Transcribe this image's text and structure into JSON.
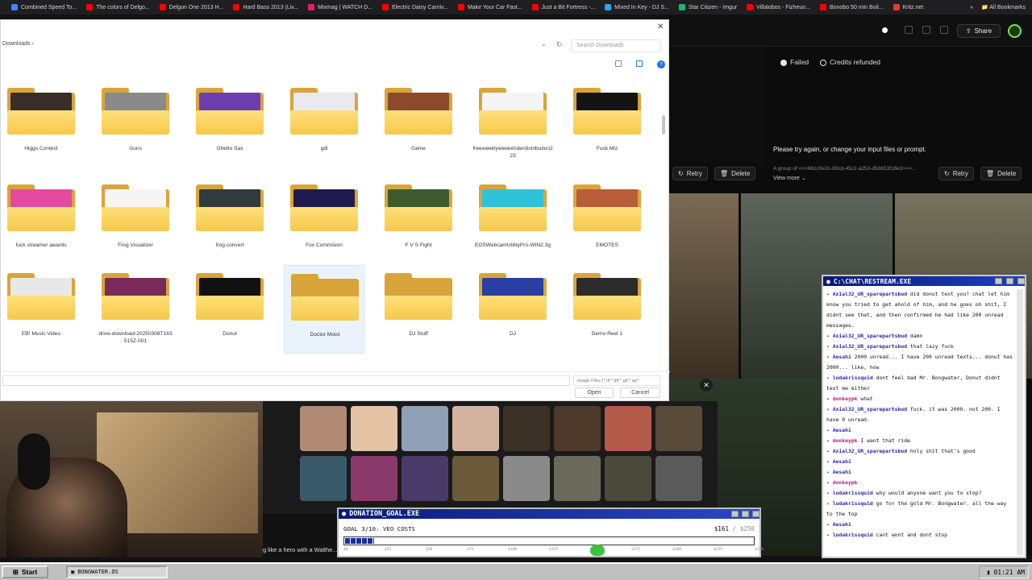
{
  "bookmarks": [
    {
      "label": "Combined Speed To...",
      "color": "#4285f4"
    },
    {
      "label": "The colors of Delgo...",
      "color": "#ff0000"
    },
    {
      "label": "Delgon One 2013 H...",
      "color": "#ff0000"
    },
    {
      "label": "Hard Bass 2013 (Liv...",
      "color": "#ff0000"
    },
    {
      "label": "Mixmag | WATCH D...",
      "color": "#e91e63"
    },
    {
      "label": "Electric Daisy Carniv...",
      "color": "#ff0000"
    },
    {
      "label": "Make Your Car Fast...",
      "color": "#ff0000"
    },
    {
      "label": "Just a Bit Fortress -...",
      "color": "#ff0000"
    },
    {
      "label": "Mixed In Key - DJ S...",
      "color": "#2aa4f4"
    },
    {
      "label": "Star Citizen - Imgur",
      "color": "#1bb76e"
    },
    {
      "label": "Villalobos - Fizheuo...",
      "color": "#ff0000"
    },
    {
      "label": "Bonobo 50 min Boil...",
      "color": "#ff0000"
    },
    {
      "label": "Kritz.net",
      "color": "#e53935"
    }
  ],
  "bookmarks_overflow": "»",
  "all_bookmarks": "All Bookmarks",
  "dialog": {
    "address": "Downloads  ›",
    "search_placeholder": "Search Downloads",
    "refresh": "↻",
    "chevron": "⌄",
    "close": "✕",
    "help": "?",
    "file_type": "Image Files (*.tif;*.jfif;*.gif;*.ap*",
    "open_label": "Open",
    "cancel_label": "Cancel"
  },
  "folders": [
    {
      "name": "Higgs Contest",
      "pic": "#3a2e2a"
    },
    {
      "name": "Guns",
      "pic": "#8a8a8a"
    },
    {
      "name": "Ghetto Sax",
      "pic": "#6c3fb0"
    },
    {
      "name": "gdl",
      "pic": "#e9e9ee"
    },
    {
      "name": "Game",
      "pic": "#8b4a2a"
    },
    {
      "name": "freeweeklyweekenderdistribution2\n23",
      "pic": "#f4f4f4"
    },
    {
      "name": "Fuck Miz",
      "pic": "#141414"
    },
    {
      "name": "fuck streamer awards",
      "pic": "#e34aa0"
    },
    {
      "name": "Frog Visualizer",
      "pic": "#f5f5f5"
    },
    {
      "name": "frog convert",
      "pic": "#2f3b3f"
    },
    {
      "name": "Fox Commision",
      "pic": "#1f1b4e"
    },
    {
      "name": "F V S Fight",
      "pic": "#3d5b2d"
    },
    {
      "name": "EOSWebcamUtilityPro-WIN2.3g",
      "pic": "#2fc2d6"
    },
    {
      "name": "EMOTES",
      "pic": "#b85c3a"
    },
    {
      "name": "EB! Music Video",
      "pic": "#e8e8e8"
    },
    {
      "name": "drive-download-20250308T163\n515Z-001",
      "pic": "#7a2a5a"
    },
    {
      "name": "Donut",
      "pic": "#111111"
    },
    {
      "name": "Doctor Moist",
      "pic": ""
    },
    {
      "name": "DJ Stuff",
      "pic": ""
    },
    {
      "name": "DJ",
      "pic": "#2a3fa4"
    },
    {
      "name": "Demo Reel 1",
      "pic": "#2c2c2c"
    }
  ],
  "app": {
    "share": "Share",
    "failed": "Failed",
    "credits": "Credits refunded",
    "try_again": "Please try again, or change your input files or prompt.",
    "group_text": "A group of <<<661c0e2c-89cd-45c2-a253-d56653f18e3>>>...",
    "view_more": "View more  ⌄",
    "retry": "Retry",
    "delete": "Delete"
  },
  "chat": {
    "title": "C:\\CHAT\\RESTREAM.EXE",
    "messages": [
      {
        "user": "Axial32_UR_sparepartsbud",
        "text": "did donut text you? chat let him know you tried to get ahold of him, and he goes oh shit, I didnt see that, and then confirmed he had like 200 unread messages.",
        "red": false
      },
      {
        "user": "Axial32_UR_sparepartsbud",
        "text": "damn",
        "red": false
      },
      {
        "user": "Axial32_UR_sparepartsbud",
        "text": "that lazy fuck",
        "red": false
      },
      {
        "user": "Aesahi",
        "text": "2000 unread... I have 200 unread texts... donut has 2000... like, how",
        "red": false
      },
      {
        "user": "ludakrissquid",
        "text": "dont feel bad Mr. Bongwater, Donut didnt text me either",
        "red": false
      },
      {
        "user": "donkeypk",
        "text": "what",
        "red": true
      },
      {
        "user": "Axial32_UR_sparepartsbud",
        "text": "fuck. it was 2000. not 200. I have 0 unread.",
        "red": false
      },
      {
        "user": "Aesahi",
        "text": "",
        "red": false
      },
      {
        "user": "donkeypk",
        "text": "I want that ride",
        "red": true
      },
      {
        "user": "Axial32_UR_sparepartsbud",
        "text": "holy shit that's good",
        "red": false
      },
      {
        "user": "Aesahi",
        "text": "",
        "red": false
      },
      {
        "user": "Aesahi",
        "text": "",
        "red": false
      },
      {
        "user": "donkeypk",
        "text": "",
        "red": true
      },
      {
        "user": "ludakrissquid",
        "text": "why would anyone want you to stop?",
        "red": false
      },
      {
        "user": "ludakrissquid",
        "text": "go for the gold Mr. Bongwater. all the way to the top",
        "red": false
      },
      {
        "user": "Aesahi",
        "text": "",
        "red": false
      },
      {
        "user": "ludakrissquid",
        "text": "cant wont and dont stop",
        "red": false
      }
    ]
  },
  "stream": {
    "thumb_caption": "g like a hero with a Walthe... ...ne a rockina with a d..."
  },
  "donation": {
    "title": "DONATION_GOAL.EXE",
    "goal_label": "GOAL 3/10: VEO COSTS",
    "current": "$161",
    "separator": " / ",
    "target": "$250",
    "progress": 0.644,
    "tick_labels": [
      "$0",
      "$25",
      "$50",
      "$75",
      "$100",
      "$125",
      "$150",
      "$175",
      "$200",
      "$225",
      "$250"
    ]
  },
  "taskbar": {
    "start": "Start",
    "task": "BONGWATER.OS",
    "clock": "01:21 AM"
  }
}
